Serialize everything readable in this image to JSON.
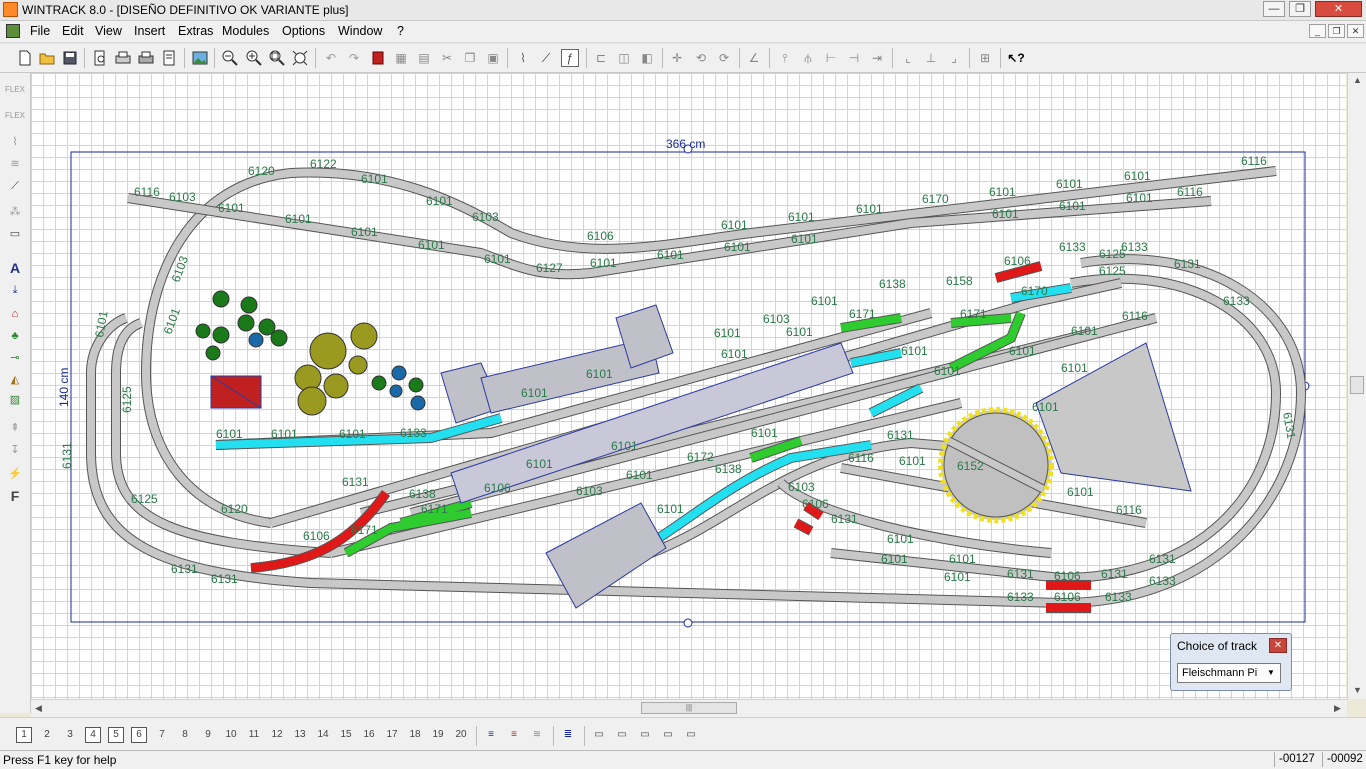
{
  "window": {
    "title": "WINTRACK 8.0 - [DISEÑO DEFINITIVO OK VARIANTE plus]",
    "buttons": {
      "minimize": "—",
      "maximize": "❐",
      "close": "✕"
    }
  },
  "menu": {
    "items": [
      "File",
      "Edit",
      "View",
      "Insert",
      "Extras",
      "Modules",
      "Options",
      "Window",
      "?"
    ],
    "mdi_buttons": {
      "minimize": "_",
      "restore": "❐",
      "close": "✕"
    }
  },
  "toolbar": {
    "icons": [
      "new-file",
      "open-folder",
      "save",
      "print-preview",
      "print",
      "print-setup",
      "page-setup",
      "image",
      "zoom-out",
      "zoom-in",
      "zoom-window",
      "zoom-fit",
      "undo",
      "redo",
      "delete",
      "copy-window",
      "paste-window",
      "cut",
      "copy",
      "paste",
      "flex-track",
      "curve-track",
      "free-draw",
      "track-join",
      "track-align",
      "track-group",
      "rotate",
      "rotate-90",
      "rotate-180",
      "angle",
      "mirror",
      "split-vertical",
      "split-horizontal",
      "connect",
      "gap",
      "align-left",
      "align-center",
      "align-right",
      "grid",
      "help-arrow"
    ]
  },
  "left_toolbar": {
    "icons": [
      "flex-track",
      "flex-track-2",
      "height",
      "slope",
      "bridge",
      "terrain",
      "text",
      "marker",
      "house",
      "tree",
      "signal",
      "contour",
      "landscape",
      "gauge",
      "measure",
      "catenary",
      "font"
    ]
  },
  "layout": {
    "dimension_width": "366 cm",
    "dimension_height": "140 cm",
    "track_labels": [
      "6120",
      "6122",
      "6101",
      "6101",
      "6103",
      "6106",
      "6101",
      "6101",
      "6101",
      "6170",
      "6101",
      "6101",
      "6101",
      "6116",
      "6116",
      "6103",
      "6101",
      "6101",
      "6101",
      "6101",
      "6101",
      "6127",
      "6101",
      "6101",
      "6101",
      "6101",
      "6101",
      "6101",
      "6101",
      "6116",
      "6133",
      "6133",
      "6106",
      "6125",
      "6131",
      "6133",
      "6138",
      "6158",
      "6170",
      "6101",
      "6171",
      "6171",
      "6101",
      "6103",
      "6101",
      "6101",
      "6101",
      "6101",
      "6101",
      "6101",
      "6101",
      "6101",
      "6116",
      "6133",
      "6101",
      "6101",
      "6101",
      "6131",
      "6120",
      "6106",
      "6131",
      "6125",
      "6131",
      "6131",
      "6125",
      "6138",
      "6171",
      "6171",
      "6172",
      "6101",
      "6138",
      "6106",
      "6103",
      "6101",
      "6101",
      "6101",
      "6101",
      "6131",
      "6116",
      "6101",
      "6152",
      "6101",
      "6101",
      "6116",
      "6101",
      "6106",
      "6106",
      "6131",
      "6131",
      "6133",
      "6133",
      "6106",
      "6101",
      "6101",
      "6103",
      "6131",
      "6101",
      "6101",
      "6133",
      "6131",
      "6125",
      "6101",
      "6131",
      "6101",
      "6103"
    ]
  },
  "choice_of_track": {
    "title": "Choice of track",
    "selected": "Fleischmann Pi"
  },
  "layers": {
    "items": [
      "1",
      "2",
      "3",
      "4",
      "5",
      "6",
      "7",
      "8",
      "9",
      "10",
      "11",
      "12",
      "13",
      "14",
      "15",
      "16",
      "17",
      "18",
      "19",
      "20"
    ],
    "pressed": [
      "1",
      "4",
      "5",
      "6"
    ]
  },
  "status": {
    "help": "Press F1 key for help",
    "x": "-00127",
    "y": "-00092"
  },
  "colors": {
    "track": "#c8c8c8",
    "track_edge": "#555555",
    "turnout_green": "#2ecc2e",
    "cyan": "#22e0f0",
    "red": "#e01818",
    "label": "#2a7a4a",
    "frame": "#1a2a9a"
  }
}
